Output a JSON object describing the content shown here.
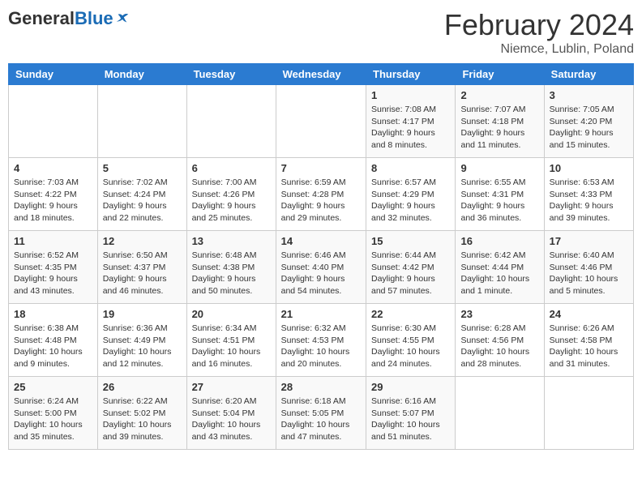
{
  "header": {
    "logo_general": "General",
    "logo_blue": "Blue",
    "month": "February 2024",
    "location": "Niemce, Lublin, Poland"
  },
  "days_of_week": [
    "Sunday",
    "Monday",
    "Tuesday",
    "Wednesday",
    "Thursday",
    "Friday",
    "Saturday"
  ],
  "weeks": [
    [
      {
        "day": "",
        "info": ""
      },
      {
        "day": "",
        "info": ""
      },
      {
        "day": "",
        "info": ""
      },
      {
        "day": "",
        "info": ""
      },
      {
        "day": "1",
        "info": "Sunrise: 7:08 AM\nSunset: 4:17 PM\nDaylight: 9 hours\nand 8 minutes."
      },
      {
        "day": "2",
        "info": "Sunrise: 7:07 AM\nSunset: 4:18 PM\nDaylight: 9 hours\nand 11 minutes."
      },
      {
        "day": "3",
        "info": "Sunrise: 7:05 AM\nSunset: 4:20 PM\nDaylight: 9 hours\nand 15 minutes."
      }
    ],
    [
      {
        "day": "4",
        "info": "Sunrise: 7:03 AM\nSunset: 4:22 PM\nDaylight: 9 hours\nand 18 minutes."
      },
      {
        "day": "5",
        "info": "Sunrise: 7:02 AM\nSunset: 4:24 PM\nDaylight: 9 hours\nand 22 minutes."
      },
      {
        "day": "6",
        "info": "Sunrise: 7:00 AM\nSunset: 4:26 PM\nDaylight: 9 hours\nand 25 minutes."
      },
      {
        "day": "7",
        "info": "Sunrise: 6:59 AM\nSunset: 4:28 PM\nDaylight: 9 hours\nand 29 minutes."
      },
      {
        "day": "8",
        "info": "Sunrise: 6:57 AM\nSunset: 4:29 PM\nDaylight: 9 hours\nand 32 minutes."
      },
      {
        "day": "9",
        "info": "Sunrise: 6:55 AM\nSunset: 4:31 PM\nDaylight: 9 hours\nand 36 minutes."
      },
      {
        "day": "10",
        "info": "Sunrise: 6:53 AM\nSunset: 4:33 PM\nDaylight: 9 hours\nand 39 minutes."
      }
    ],
    [
      {
        "day": "11",
        "info": "Sunrise: 6:52 AM\nSunset: 4:35 PM\nDaylight: 9 hours\nand 43 minutes."
      },
      {
        "day": "12",
        "info": "Sunrise: 6:50 AM\nSunset: 4:37 PM\nDaylight: 9 hours\nand 46 minutes."
      },
      {
        "day": "13",
        "info": "Sunrise: 6:48 AM\nSunset: 4:38 PM\nDaylight: 9 hours\nand 50 minutes."
      },
      {
        "day": "14",
        "info": "Sunrise: 6:46 AM\nSunset: 4:40 PM\nDaylight: 9 hours\nand 54 minutes."
      },
      {
        "day": "15",
        "info": "Sunrise: 6:44 AM\nSunset: 4:42 PM\nDaylight: 9 hours\nand 57 minutes."
      },
      {
        "day": "16",
        "info": "Sunrise: 6:42 AM\nSunset: 4:44 PM\nDaylight: 10 hours\nand 1 minute."
      },
      {
        "day": "17",
        "info": "Sunrise: 6:40 AM\nSunset: 4:46 PM\nDaylight: 10 hours\nand 5 minutes."
      }
    ],
    [
      {
        "day": "18",
        "info": "Sunrise: 6:38 AM\nSunset: 4:48 PM\nDaylight: 10 hours\nand 9 minutes."
      },
      {
        "day": "19",
        "info": "Sunrise: 6:36 AM\nSunset: 4:49 PM\nDaylight: 10 hours\nand 12 minutes."
      },
      {
        "day": "20",
        "info": "Sunrise: 6:34 AM\nSunset: 4:51 PM\nDaylight: 10 hours\nand 16 minutes."
      },
      {
        "day": "21",
        "info": "Sunrise: 6:32 AM\nSunset: 4:53 PM\nDaylight: 10 hours\nand 20 minutes."
      },
      {
        "day": "22",
        "info": "Sunrise: 6:30 AM\nSunset: 4:55 PM\nDaylight: 10 hours\nand 24 minutes."
      },
      {
        "day": "23",
        "info": "Sunrise: 6:28 AM\nSunset: 4:56 PM\nDaylight: 10 hours\nand 28 minutes."
      },
      {
        "day": "24",
        "info": "Sunrise: 6:26 AM\nSunset: 4:58 PM\nDaylight: 10 hours\nand 31 minutes."
      }
    ],
    [
      {
        "day": "25",
        "info": "Sunrise: 6:24 AM\nSunset: 5:00 PM\nDaylight: 10 hours\nand 35 minutes."
      },
      {
        "day": "26",
        "info": "Sunrise: 6:22 AM\nSunset: 5:02 PM\nDaylight: 10 hours\nand 39 minutes."
      },
      {
        "day": "27",
        "info": "Sunrise: 6:20 AM\nSunset: 5:04 PM\nDaylight: 10 hours\nand 43 minutes."
      },
      {
        "day": "28",
        "info": "Sunrise: 6:18 AM\nSunset: 5:05 PM\nDaylight: 10 hours\nand 47 minutes."
      },
      {
        "day": "29",
        "info": "Sunrise: 6:16 AM\nSunset: 5:07 PM\nDaylight: 10 hours\nand 51 minutes."
      },
      {
        "day": "",
        "info": ""
      },
      {
        "day": "",
        "info": ""
      }
    ]
  ]
}
